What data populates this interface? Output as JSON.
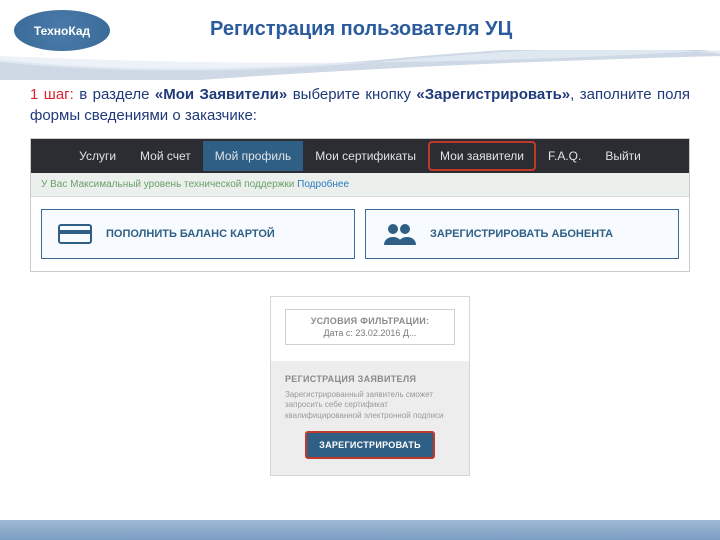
{
  "brand": "ТехноКад",
  "title": "Регистрация пользователя УЦ",
  "instruction": {
    "step": "1 шаг:",
    "t1": " в разделе ",
    "b1": "«Мои Заявители»",
    "t2": " выберите кнопку ",
    "b2": "«Зарегистрировать»",
    "t3": ", заполните поля формы сведениями о заказчике:"
  },
  "nav": {
    "services": "Услуги",
    "account": "Мой счет",
    "profile": "Мой профиль",
    "certs": "Мои сертификаты",
    "applicants": "Мои заявители",
    "faq": "F.A.Q.",
    "exit": "Выйти"
  },
  "notice": {
    "text": "У Вас Максимальный уровень технической поддержки ",
    "link": "Подробнее"
  },
  "big_buttons": {
    "topup": "ПОПОЛНИТЬ БАЛАНС КАРТОЙ",
    "register_sub": "ЗАРЕГИСТРИРОВАТЬ АБОНЕНТА"
  },
  "panel": {
    "filter_title": "УСЛОВИЯ ФИЛЬТРАЦИИ:",
    "filter_date": "Дата с: 23.02.2016 Д...",
    "reg_title": "РЕГИСТРАЦИЯ ЗАЯВИТЕЛЯ",
    "reg_desc": "Зарегистрированный заявитель сможет запросить себе сертификат квалифицированной электронной подписи",
    "reg_button": "ЗАРЕГИСТРИРОВАТЬ"
  }
}
